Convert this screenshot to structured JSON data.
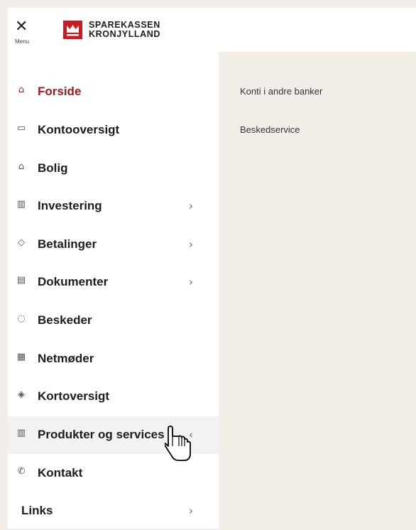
{
  "header": {
    "menu_close_icon": "close-icon",
    "menu_label": "Menu",
    "brand_line1": "SPAREKASSEN",
    "brand_line2": "KRONJYLLAND",
    "brand_color": "#d0191f"
  },
  "sidebar": {
    "items": [
      {
        "label": "Forside",
        "icon": "home-icon",
        "active": true
      },
      {
        "label": "Kontooversigt",
        "icon": "wallet-icon"
      },
      {
        "label": "Bolig",
        "icon": "house-icon"
      },
      {
        "label": "Investering",
        "icon": "chart-icon",
        "chevron": "›"
      },
      {
        "label": "Betalinger",
        "icon": "payment-icon",
        "chevron": "›"
      },
      {
        "label": "Dokumenter",
        "icon": "document-icon",
        "chevron": "›"
      },
      {
        "label": "Beskeder",
        "icon": "chat-icon"
      },
      {
        "label": "Netmøder",
        "icon": "calendar-icon"
      },
      {
        "label": "Kortoversigt",
        "icon": "card-icon"
      },
      {
        "label": "Produkter og services",
        "icon": "building-icon",
        "chevron": "‹",
        "hovered": true
      },
      {
        "label": "Kontakt",
        "icon": "phone-icon"
      },
      {
        "label": "Links",
        "chevron": "›"
      }
    ],
    "active_color": "#a2191f"
  },
  "submenu": {
    "items": [
      {
        "label": "Konti i andre banker"
      },
      {
        "label": "Beskedservice"
      }
    ]
  }
}
